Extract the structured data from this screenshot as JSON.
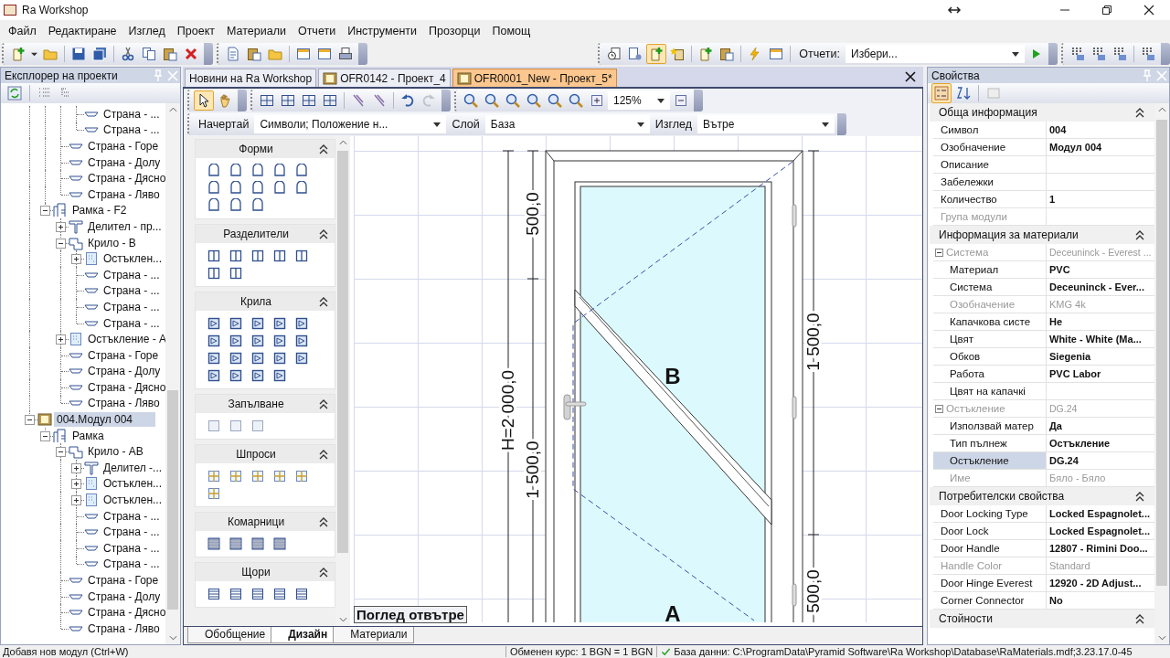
{
  "window": {
    "title": "Ra Workshop"
  },
  "menu": [
    "Файл",
    "Редактиране",
    "Изглед",
    "Проект",
    "Материали",
    "Отчети",
    "Инструменти",
    "Прозорци",
    "Помощ"
  ],
  "toolbar": {
    "reports_label": "Отчети:",
    "reports_value": "Избери..."
  },
  "explorer": {
    "title": "Експлорер на проекти",
    "tree": [
      {
        "children": [
          {
            "children": [
              {
                "children": [
                  {
                    "children": [
                      {
                        "label": "Страна - ...",
                        "kind": "side",
                        "selected": false
                      },
                      {
                        "label": "Страна - ...",
                        "kind": "side",
                        "selected": false
                      }
                    ]
                  },
                  {
                    "label": "Страна - Горе",
                    "kind": "side",
                    "selected": false
                  },
                  {
                    "label": "Страна - Долу",
                    "kind": "side",
                    "selected": false
                  },
                  {
                    "label": "Страна - Дясно",
                    "kind": "side",
                    "selected": false
                  },
                  {
                    "label": "Страна - Ляво",
                    "kind": "side",
                    "selected": false
                  }
                ]
              },
              {
                "label": "Рамка - F2",
                "kind": "frame",
                "expanded": true,
                "selected": false,
                "children": [
                  {
                    "label": "Делител - пр...",
                    "kind": "divider",
                    "expanded": false,
                    "selected": false
                  },
                  {
                    "label": "Крило - B",
                    "kind": "sash",
                    "expanded": true,
                    "selected": false,
                    "children": [
                      {
                        "label": "Остъклен...",
                        "kind": "glazing",
                        "expanded": false,
                        "selected": false
                      },
                      {
                        "label": "Страна - ...",
                        "kind": "side",
                        "selected": false
                      },
                      {
                        "label": "Страна - ...",
                        "kind": "side",
                        "selected": false
                      },
                      {
                        "label": "Страна - ...",
                        "kind": "side",
                        "selected": false
                      },
                      {
                        "label": "Страна - ...",
                        "kind": "side",
                        "selected": false
                      }
                    ]
                  },
                  {
                    "label": "Остъкление - A",
                    "kind": "glazing",
                    "expanded": false,
                    "selected": false
                  },
                  {
                    "label": "Страна - Горе",
                    "kind": "side",
                    "selected": false
                  },
                  {
                    "label": "Страна - Долу",
                    "kind": "side",
                    "selected": false
                  },
                  {
                    "label": "Страна - Дясно",
                    "kind": "side",
                    "selected": false
                  },
                  {
                    "label": "Страна - Ляво",
                    "kind": "side",
                    "selected": false
                  }
                ]
              }
            ]
          },
          {
            "label": "004.Модул 004",
            "kind": "module",
            "expanded": true,
            "selected": true,
            "children": [
              {
                "label": "Рамка",
                "kind": "frame",
                "expanded": true,
                "selected": false,
                "children": [
                  {
                    "label": "Крило - AB",
                    "kind": "sash",
                    "expanded": true,
                    "selected": false,
                    "children": [
                      {
                        "label": "Делител -...",
                        "kind": "divider",
                        "expanded": false,
                        "selected": false
                      },
                      {
                        "label": "Остъклен...",
                        "kind": "glazing",
                        "expanded": false,
                        "selected": false
                      },
                      {
                        "label": "Остъклен...",
                        "kind": "glazing",
                        "expanded": false,
                        "selected": false
                      },
                      {
                        "label": "Страна - ...",
                        "kind": "side",
                        "selected": false
                      },
                      {
                        "label": "Страна - ...",
                        "kind": "side",
                        "selected": false
                      },
                      {
                        "label": "Страна - ...",
                        "kind": "side",
                        "selected": false
                      },
                      {
                        "label": "Страна - ...",
                        "kind": "side",
                        "selected": false
                      }
                    ]
                  },
                  {
                    "label": "Страна - Горе",
                    "kind": "side",
                    "selected": false
                  },
                  {
                    "label": "Страна - Долу",
                    "kind": "side",
                    "selected": false
                  },
                  {
                    "label": "Страна - Дясно",
                    "kind": "side",
                    "selected": false
                  },
                  {
                    "label": "Страна - Ляво",
                    "kind": "side",
                    "selected": false
                  }
                ]
              }
            ]
          }
        ]
      }
    ]
  },
  "document_tabs": [
    {
      "label": "Новини на Ra Workshop",
      "kind": "news",
      "selected": false
    },
    {
      "label": "OFR0142 - Проект_4",
      "kind": "project",
      "selected": false
    },
    {
      "label": "OFR0001_New - Проект_5*",
      "kind": "project",
      "selected": true
    }
  ],
  "design_toolbar": {
    "zoom": "125%",
    "draw_label": "Начертай",
    "draw_value": "Символи; Положение н...",
    "layer_label": "Слой",
    "layer_value": "База",
    "view_label": "Изглед",
    "view_value": "Вътре"
  },
  "palette": [
    {
      "title": "Форми",
      "expanded": true
    },
    {
      "title": "Разделители",
      "expanded": true
    },
    {
      "title": "Крила",
      "expanded": true
    },
    {
      "title": "Запълване",
      "expanded": true
    },
    {
      "title": "Шпроси",
      "expanded": true
    },
    {
      "title": "Комарници",
      "expanded": true
    },
    {
      "title": "Щори",
      "expanded": true
    }
  ],
  "drawing": {
    "height_dimension": "H=2 000,0",
    "left_dimensions": [
      "500,0",
      "1 500,0"
    ],
    "right_dimensions": [
      "1 500,0",
      "500,0"
    ],
    "sash_labels": [
      "B",
      "A"
    ],
    "view_caption": "Поглед отвътре"
  },
  "bottom_tabs": [
    {
      "label": "Обобщение",
      "selected": false
    },
    {
      "label": "Дизайн",
      "selected": true
    },
    {
      "label": "Материали",
      "selected": false
    }
  ],
  "properties": {
    "title": "Свойства",
    "categories": [
      {
        "title": "Обща информация",
        "expanded": true,
        "rows": [
          {
            "name": "Символ",
            "value": "004",
            "disabled": false,
            "selected": false
          },
          {
            "name": "Озобначение",
            "value": "Модул 004",
            "disabled": false,
            "selected": false
          },
          {
            "name": "Описание",
            "disabled": false,
            "selected": false
          },
          {
            "name": "Забележки",
            "disabled": false,
            "selected": false
          },
          {
            "name": "Количество",
            "value": "1",
            "disabled": false,
            "selected": false
          },
          {
            "name": "Група модули",
            "disabled": true,
            "selected": false
          }
        ]
      },
      {
        "title": "Информация за материали",
        "expanded": true,
        "rows": [
          {
            "name": "Система",
            "value": "Deceuninck - Everest ...",
            "disabled": true,
            "selected": false,
            "expanded": true,
            "children": [
              {
                "name": "Материал",
                "value": "PVC",
                "disabled": false,
                "selected": false
              },
              {
                "name": "Система",
                "value": "Deceuninck - Ever...",
                "disabled": false,
                "selected": false
              },
              {
                "name": "Озобначение",
                "value": "KMG 4k",
                "disabled": true,
                "selected": false
              },
              {
                "name": "Капачкова систе",
                "value": "Не",
                "disabled": false,
                "selected": false
              },
              {
                "name": "Цвят",
                "value": "White - White (Ma...",
                "disabled": false,
                "selected": false
              },
              {
                "name": "Обков",
                "value": "Siegenia",
                "disabled": false,
                "selected": false
              },
              {
                "name": "Работа",
                "value": "PVC Labor",
                "disabled": false,
                "selected": false
              },
              {
                "name": "Цвят на капачкі",
                "disabled": false,
                "selected": false
              }
            ]
          },
          {
            "name": "Остъкление",
            "value": "DG.24",
            "disabled": true,
            "selected": false,
            "expanded": true,
            "children": [
              {
                "name": "Използвай матер",
                "value": "Да",
                "disabled": false,
                "selected": false
              },
              {
                "name": "Тип пълнеж",
                "value": "Остъкление",
                "disabled": false,
                "selected": false
              },
              {
                "name": "Остъкление",
                "value": "DG.24",
                "disabled": false,
                "selected": true
              },
              {
                "name": "Име",
                "value": "Бяло - Бяло",
                "disabled": true,
                "selected": false
              }
            ]
          }
        ]
      },
      {
        "title": "Потребителски свойства",
        "expanded": true,
        "rows": [
          {
            "name": "Door Locking Type",
            "value": "Locked Espagnolet...",
            "disabled": false,
            "selected": false
          },
          {
            "name": "Door Lock",
            "value": "Locked Espagnolet...",
            "disabled": false,
            "selected": false
          },
          {
            "name": "Door Handle",
            "value": "12807 - Rimini Doo...",
            "disabled": false,
            "selected": false
          },
          {
            "name": "Handle Color",
            "value": "Standard",
            "disabled": true,
            "selected": false
          },
          {
            "name": "Door Hinge Everest",
            "value": "12920 - 2D Adjust...",
            "disabled": false,
            "selected": false
          },
          {
            "name": "Corner Connector",
            "value": "No",
            "disabled": false,
            "selected": false
          }
        ]
      },
      {
        "title": "Стойности",
        "expanded": true
      }
    ]
  },
  "status_bar": {
    "message": "Добавя нов модул (Ctrl+W)",
    "exchange_rate": "Обменен курс: 1 BGN = 1 BGN",
    "database": "База данни: C:\\ProgramData\\Pyramid Software\\Ra Workshop\\Database\\RaMaterials.mdf;3.23.17.0-45"
  }
}
